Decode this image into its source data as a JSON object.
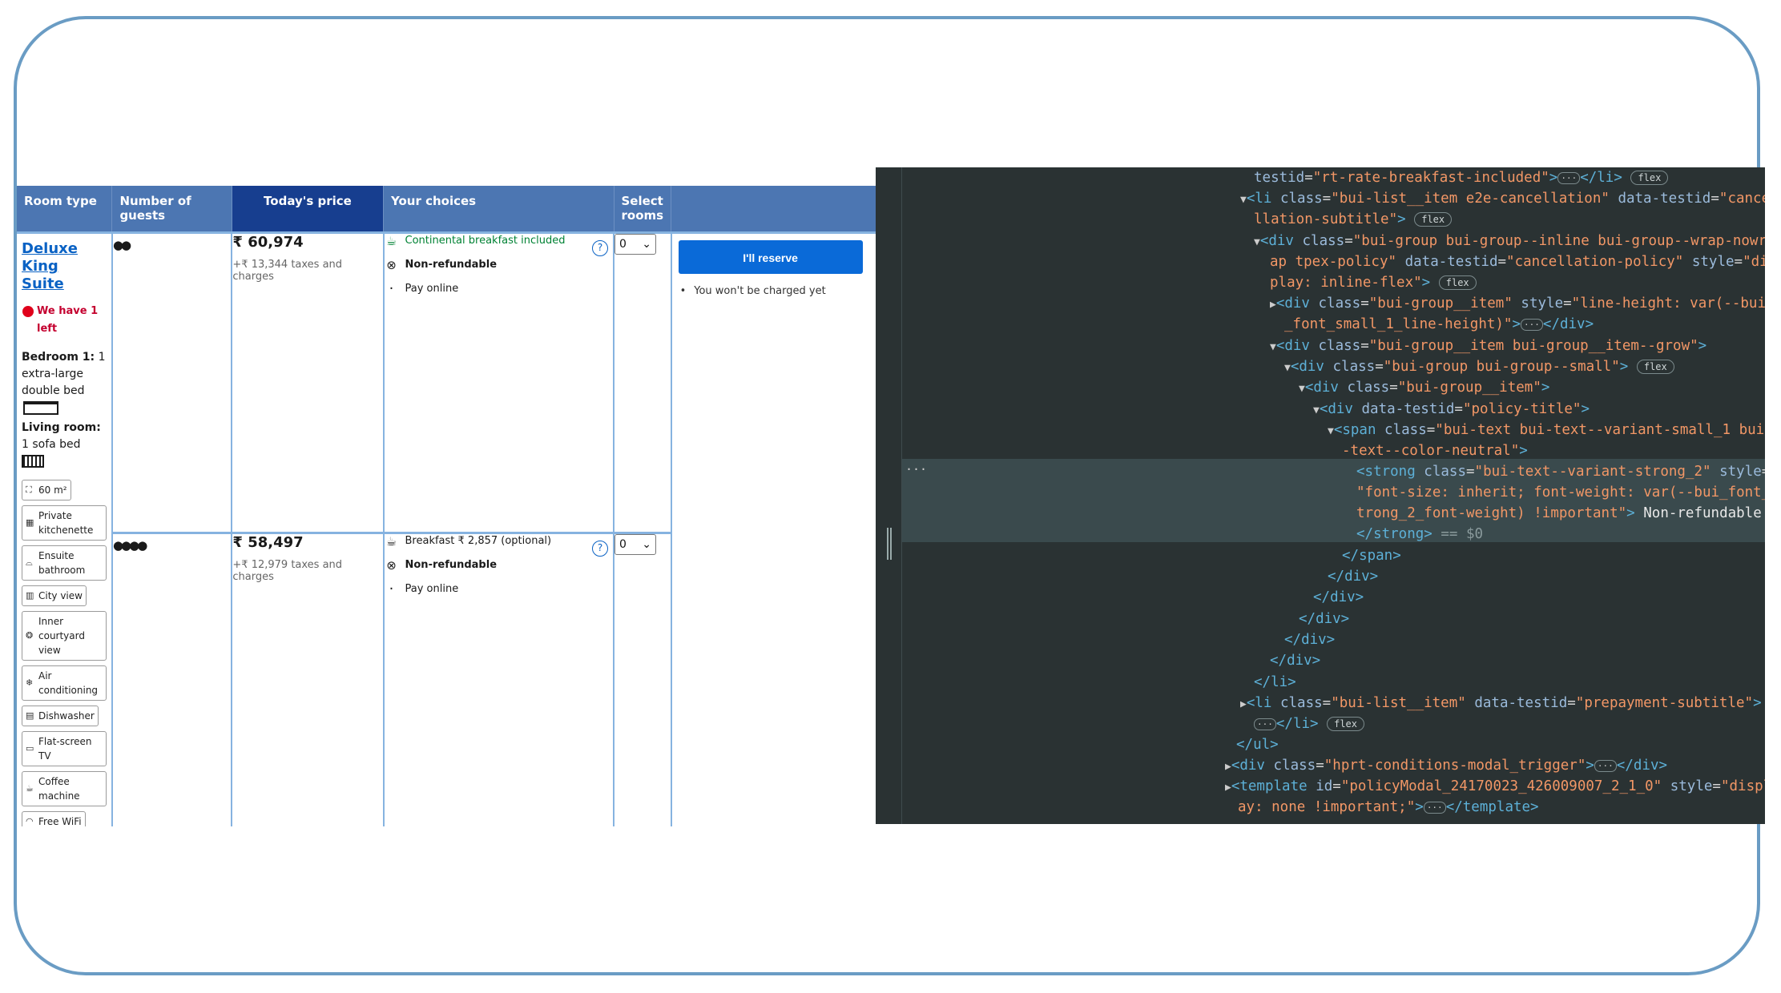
{
  "table": {
    "headers": {
      "room_type": "Room type",
      "guests": "Number of guests",
      "price": "Today's price",
      "choices": "Your choices",
      "select": "Select rooms"
    },
    "room": {
      "name_lines": [
        "Deluxe",
        "King",
        "Suite"
      ],
      "availability": "We have 1 left",
      "bedroom_label": "Bedroom 1:",
      "bedroom_detail": "1 extra-large double bed",
      "living_label": "Living room:",
      "living_detail": "1 sofa bed",
      "facilities": [
        {
          "icon": "size-icon",
          "label": "60 m²"
        },
        {
          "icon": "kitchen-icon",
          "label": "Private kitchenette"
        },
        {
          "icon": "bath-icon",
          "label": "Ensuite bathroom"
        },
        {
          "icon": "city-icon",
          "label": "City view"
        },
        {
          "icon": "courtyard-icon",
          "label": "Inner courtyard view"
        },
        {
          "icon": "snowflake-icon",
          "label": "Air conditioning"
        },
        {
          "icon": "dishwasher-icon",
          "label": "Dishwasher"
        },
        {
          "icon": "tv-icon",
          "label": "Flat-screen TV"
        },
        {
          "icon": "coffee-icon",
          "label": "Coffee machine"
        },
        {
          "icon": "wifi-icon",
          "label": "Free WiFi"
        }
      ]
    },
    "rows": [
      {
        "guests_icons": "👥",
        "price": "₹ 60,974",
        "taxes": "+₹ 13,344 taxes and charges",
        "breakfast": "Continental breakfast included",
        "cancellation": "Non-refundable",
        "payment": "Pay online",
        "select_value": "0"
      },
      {
        "guests_icons": "👥👥",
        "price": "₹ 58,497",
        "taxes": "+₹ 12,979 taxes and charges",
        "breakfast": "Breakfast ₹ 2,857 (optional)",
        "cancellation": "Non-refundable",
        "payment": "Pay online",
        "select_value": "0"
      }
    ],
    "reserve_label": "I'll reserve",
    "reserve_note": "You won't be charged yet",
    "help_glyph": "?"
  },
  "devtools": {
    "selected_marker": "== $0",
    "flex_badge": "flex",
    "ellipsis": "···"
  },
  "colors": {
    "header_blue": "#4c76b2",
    "price_header": "#173e8f",
    "link_blue": "#0a62c4",
    "reserve_blue": "#0a6ad8",
    "alert_red": "#e0001b",
    "devtools_bg": "#2a3233"
  }
}
